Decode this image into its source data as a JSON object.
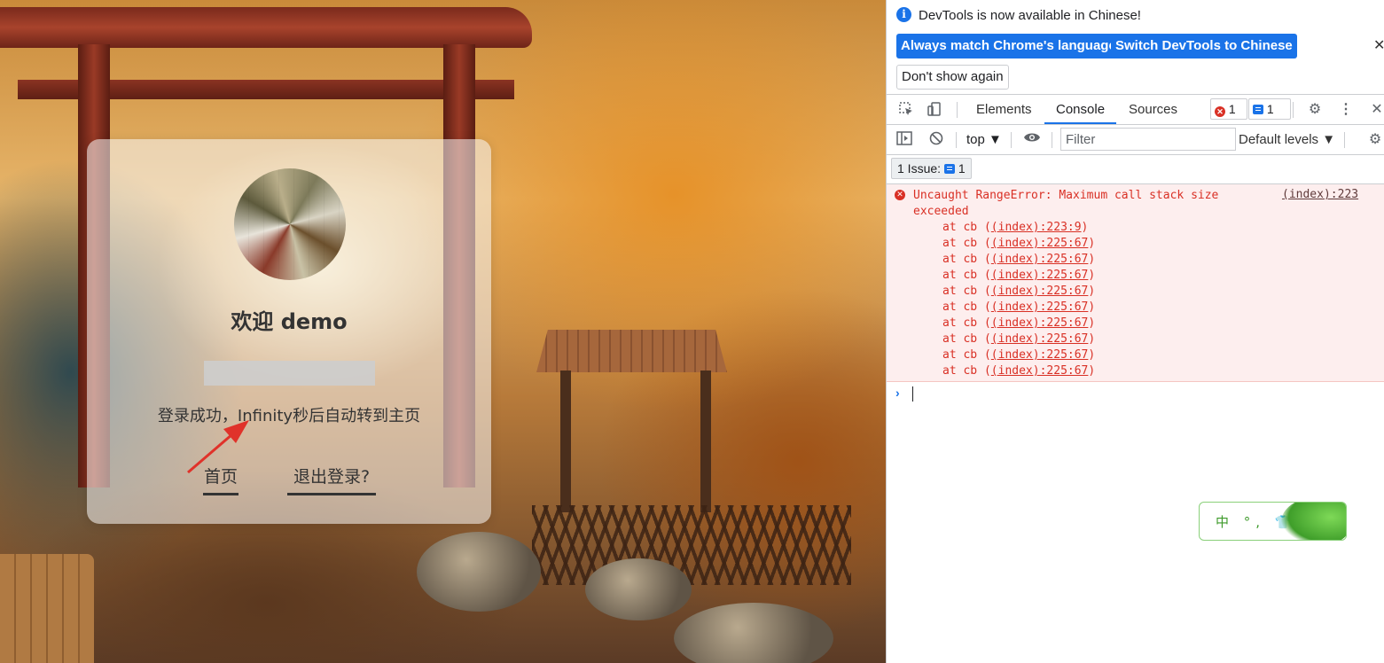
{
  "page": {
    "welcome_prefix": "欢迎 ",
    "username": "demo",
    "redirect_message": "登录成功，Infinity秒后自动转到主页",
    "link_home": "首页",
    "link_logout": "退出登录?"
  },
  "devtools": {
    "infobar": {
      "message": "DevTools is now available in Chinese!",
      "btn_match": "Always match Chrome's language",
      "btn_switch": "Switch DevTools to Chinese",
      "btn_dont_show": "Don't show again",
      "close_glyph": "✕"
    },
    "tabs": [
      {
        "label": "Elements"
      },
      {
        "label": "Console"
      },
      {
        "label": "Sources"
      }
    ],
    "error_count": "1",
    "message_count": "1",
    "toolbar": {
      "context": "top ▼",
      "filter_placeholder": "Filter",
      "levels": "Default levels ▼"
    },
    "issues": {
      "label": "1 Issue: ",
      "count": "1"
    },
    "error": {
      "message": "Uncaught RangeError: Maximum call stack size exceeded",
      "source": "(index):223",
      "stack_prefix": "at cb (",
      "stack_suffix": ")",
      "frames": [
        "(index):223:9",
        "(index):225:67",
        "(index):225:67",
        "(index):225:67",
        "(index):225:67",
        "(index):225:67",
        "(index):225:67",
        "(index):225:67",
        "(index):225:67",
        "(index):225:67"
      ]
    },
    "prompt_glyph": "›"
  },
  "ime": {
    "text": "中 °, 👕"
  },
  "colors": {
    "accent_blue": "#1a73e8",
    "error_red": "#d93025",
    "error_bg": "#fdeeee",
    "ime_green": "#3d9a2a"
  }
}
